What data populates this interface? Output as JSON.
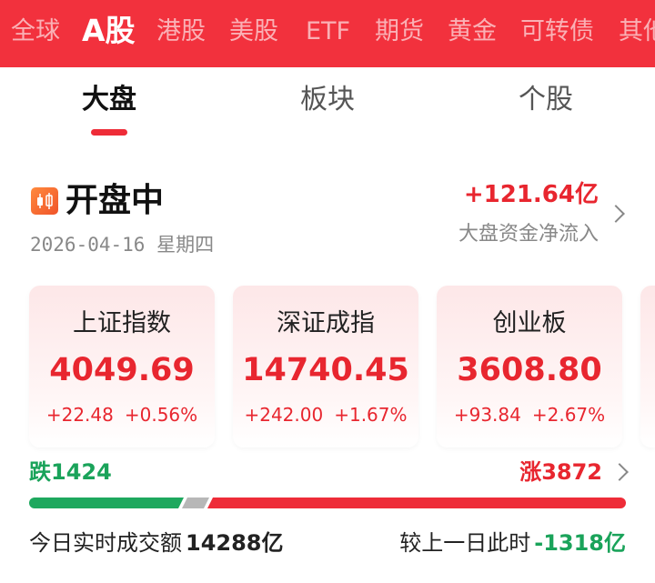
{
  "market_tabs": [
    "全球",
    "A股",
    "港股",
    "美股",
    "ETF",
    "期货",
    "黄金",
    "可转债",
    "其他"
  ],
  "active_market_tab": "A股",
  "sub_tabs": [
    "大盘",
    "板块",
    "个股"
  ],
  "active_sub_tab": "大盘",
  "status": {
    "title": "开盘中",
    "date": "2026-04-16 星期四",
    "icon": "candlestick-chart-icon"
  },
  "fund_flow": {
    "value": "+121.64亿",
    "label": "大盘资金净流入"
  },
  "indices": [
    {
      "name": "上证指数",
      "price": "4049.69",
      "change": "+22.48",
      "change_pct": "+0.56%"
    },
    {
      "name": "深证成指",
      "price": "14740.45",
      "change": "+242.00",
      "change_pct": "+1.67%"
    },
    {
      "name": "创业板",
      "price": "3608.80",
      "change": "+93.84",
      "change_pct": "+2.67%"
    }
  ],
  "breadth": {
    "down_label": "跌1424",
    "up_label": "涨3872",
    "down": 1424,
    "up": 3872
  },
  "turnover": {
    "label": "今日实时成交额",
    "value": "14288亿",
    "compare_label": "较上一日此时",
    "compare_value": "-1318亿"
  },
  "colors": {
    "brand_red": "#f2313d",
    "up_red": "#e8262f",
    "down_green": "#1aa35a",
    "flat_gray": "#b7b7b7"
  }
}
